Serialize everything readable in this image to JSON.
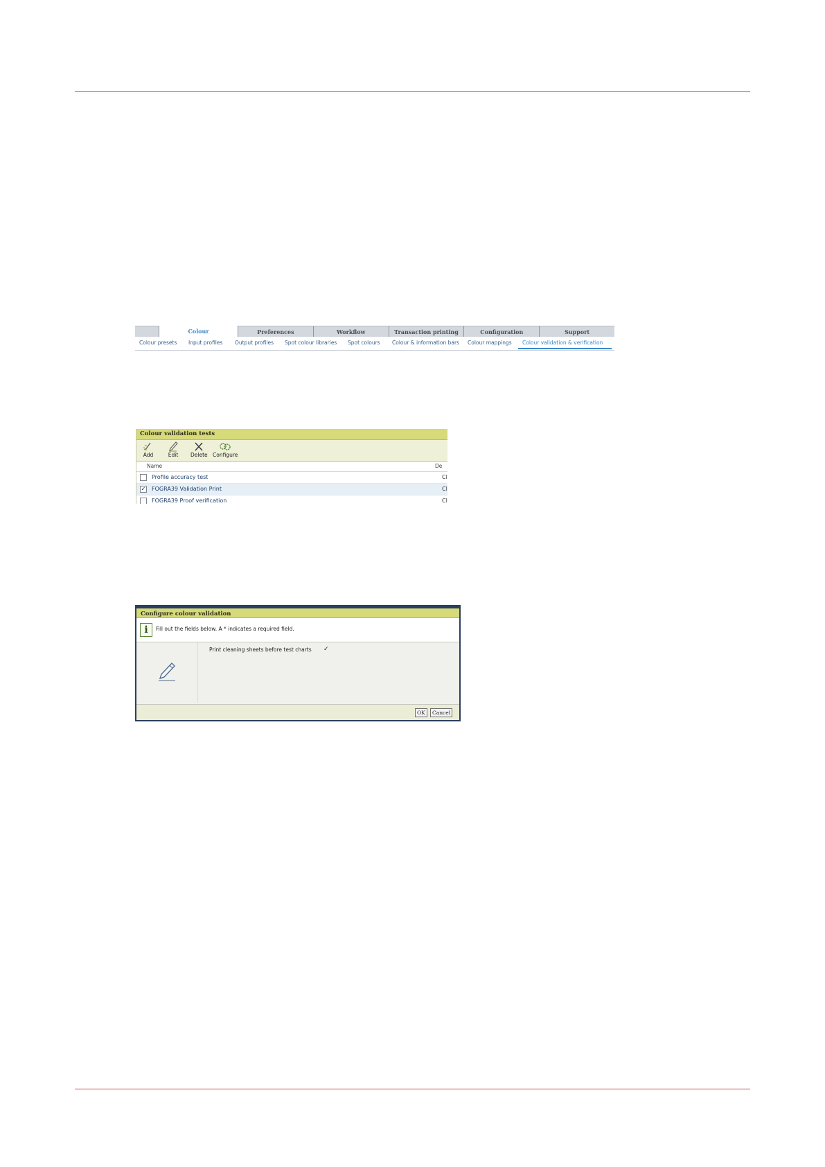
{
  "navigation": {
    "tabs": [
      "",
      "Colour",
      "Preferences",
      "Workflow",
      "Transaction printing",
      "Configuration",
      "Support"
    ],
    "active_tab": "Colour",
    "subtabs": [
      "Colour presets",
      "Input profiles",
      "Output profiles",
      "Spot colour libraries",
      "Spot colours",
      "Colour & information bars",
      "Colour mappings",
      "Colour validation & verification"
    ],
    "active_subtab": "Colour validation & verification"
  },
  "tests_panel": {
    "title": "Colour validation tests",
    "toolbar": {
      "add": "Add",
      "edit": "Edit",
      "delete": "Delete",
      "configure": "Configure"
    },
    "columns": {
      "name": "Name",
      "description": "De"
    },
    "rows": [
      {
        "name": "Profile accuracy test",
        "desc": "Cl",
        "checked": false
      },
      {
        "name": "FOGRA39 Validation Print",
        "desc": "Cl",
        "checked": true
      },
      {
        "name": "FOGRA39 Proof verification",
        "desc": "Cl",
        "checked": false
      }
    ]
  },
  "config_dialog": {
    "title": "Configure colour validation",
    "info": "Fill out the fields below. A * indicates a required field.",
    "field_label": "Print cleaning sheets before test charts",
    "field_checked": true,
    "ok": "OK",
    "cancel": "Cancel"
  },
  "colors": {
    "rule": "#c8434a",
    "panel_header": "#d6da79",
    "accent": "#3a88c8"
  }
}
